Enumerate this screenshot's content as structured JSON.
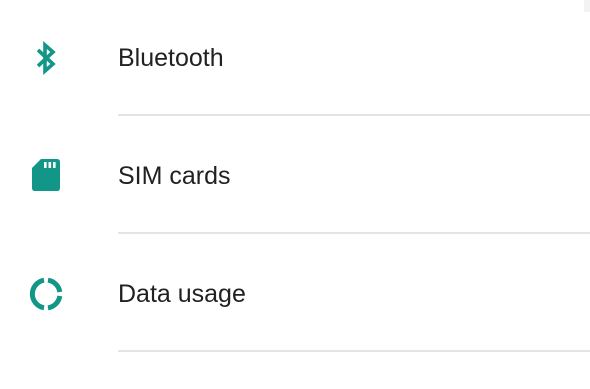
{
  "settings": {
    "items": [
      {
        "label": "Bluetooth",
        "icon": "bluetooth-icon"
      },
      {
        "label": "SIM cards",
        "icon": "sim-card-icon"
      },
      {
        "label": "Data usage",
        "icon": "data-usage-icon"
      }
    ]
  },
  "colors": {
    "accent": "#129688",
    "text": "#212121",
    "divider": "#e4e4e4"
  }
}
